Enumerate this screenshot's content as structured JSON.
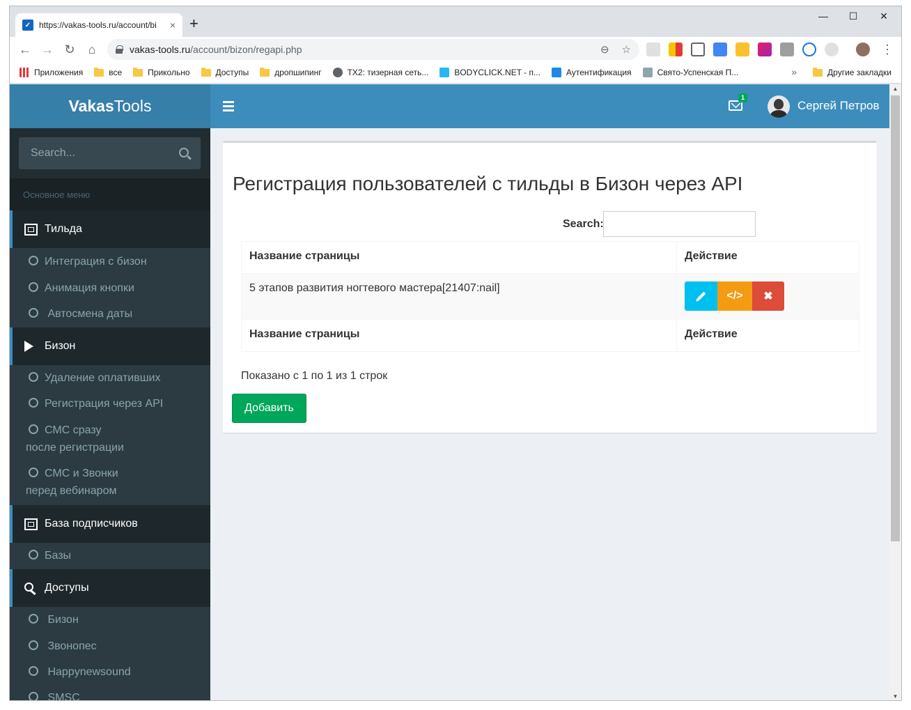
{
  "browser": {
    "tab_title": "https://vakas-tools.ru/account/bi",
    "tab_close": "×",
    "new_tab": "+",
    "url_host": "vakas-tools.ru",
    "url_path": "/account/bizon/regapi.php",
    "window_minimize": "—",
    "window_maximize": "☐",
    "window_close": "✕",
    "bookmarks": [
      {
        "label": "Приложения",
        "icon": "apps-icon"
      },
      {
        "label": "все",
        "icon": "folder-icon"
      },
      {
        "label": "Прикольно",
        "icon": "folder-icon"
      },
      {
        "label": "Доступы",
        "icon": "folder-icon"
      },
      {
        "label": "дропшипинг",
        "icon": "folder-icon"
      },
      {
        "label": "TX2: тизерная сеть...",
        "icon": "globe-icon"
      },
      {
        "label": "BODYCLICK.NET - п...",
        "icon": "site-icon"
      },
      {
        "label": "Аутентификация",
        "icon": "pulse-icon"
      },
      {
        "label": "Свято-Успенская П...",
        "icon": "site-icon"
      }
    ],
    "bookmarks_more": "»",
    "other_bookmarks": "Другие закладки"
  },
  "header": {
    "logo_bold": "Vakas",
    "logo_light": "Tools",
    "mail_count": "1",
    "user_name": "Сергей Петров"
  },
  "sidebar": {
    "search_placeholder": "Search...",
    "menu_header": "Основное меню",
    "sections": [
      {
        "label": "Тильда",
        "items": [
          "Интеграция с бизон",
          "Анимация кнопки",
          " Автосмена даты"
        ]
      },
      {
        "label": "Бизон",
        "items": [
          "Удаление оплативших",
          "Регистрация через API",
          "СМС сразу",
          "после регистрации",
          "СМС и Звонки",
          "перед вебинаром"
        ]
      },
      {
        "label": "База подписчиков",
        "items": [
          "Базы"
        ]
      },
      {
        "label": "Доступы",
        "items": [
          " Бизон",
          " Звонопес",
          " Happynewsound",
          " SMSC"
        ]
      }
    ]
  },
  "main": {
    "title": "Регистрация пользователей с тильды в Бизон через API",
    "search_label": "Search:",
    "table": {
      "header": [
        "Название страницы",
        "Действие"
      ],
      "rows": [
        {
          "name": "5 этапов развития ногтевого мастера[21407:nail]"
        }
      ],
      "footer": [
        "Название страницы",
        "Действие"
      ]
    },
    "code_icon": "</>",
    "delete_icon": "✖",
    "info": "Показано с 1 по 1 из 1 строк",
    "add_button": "Добавить"
  }
}
